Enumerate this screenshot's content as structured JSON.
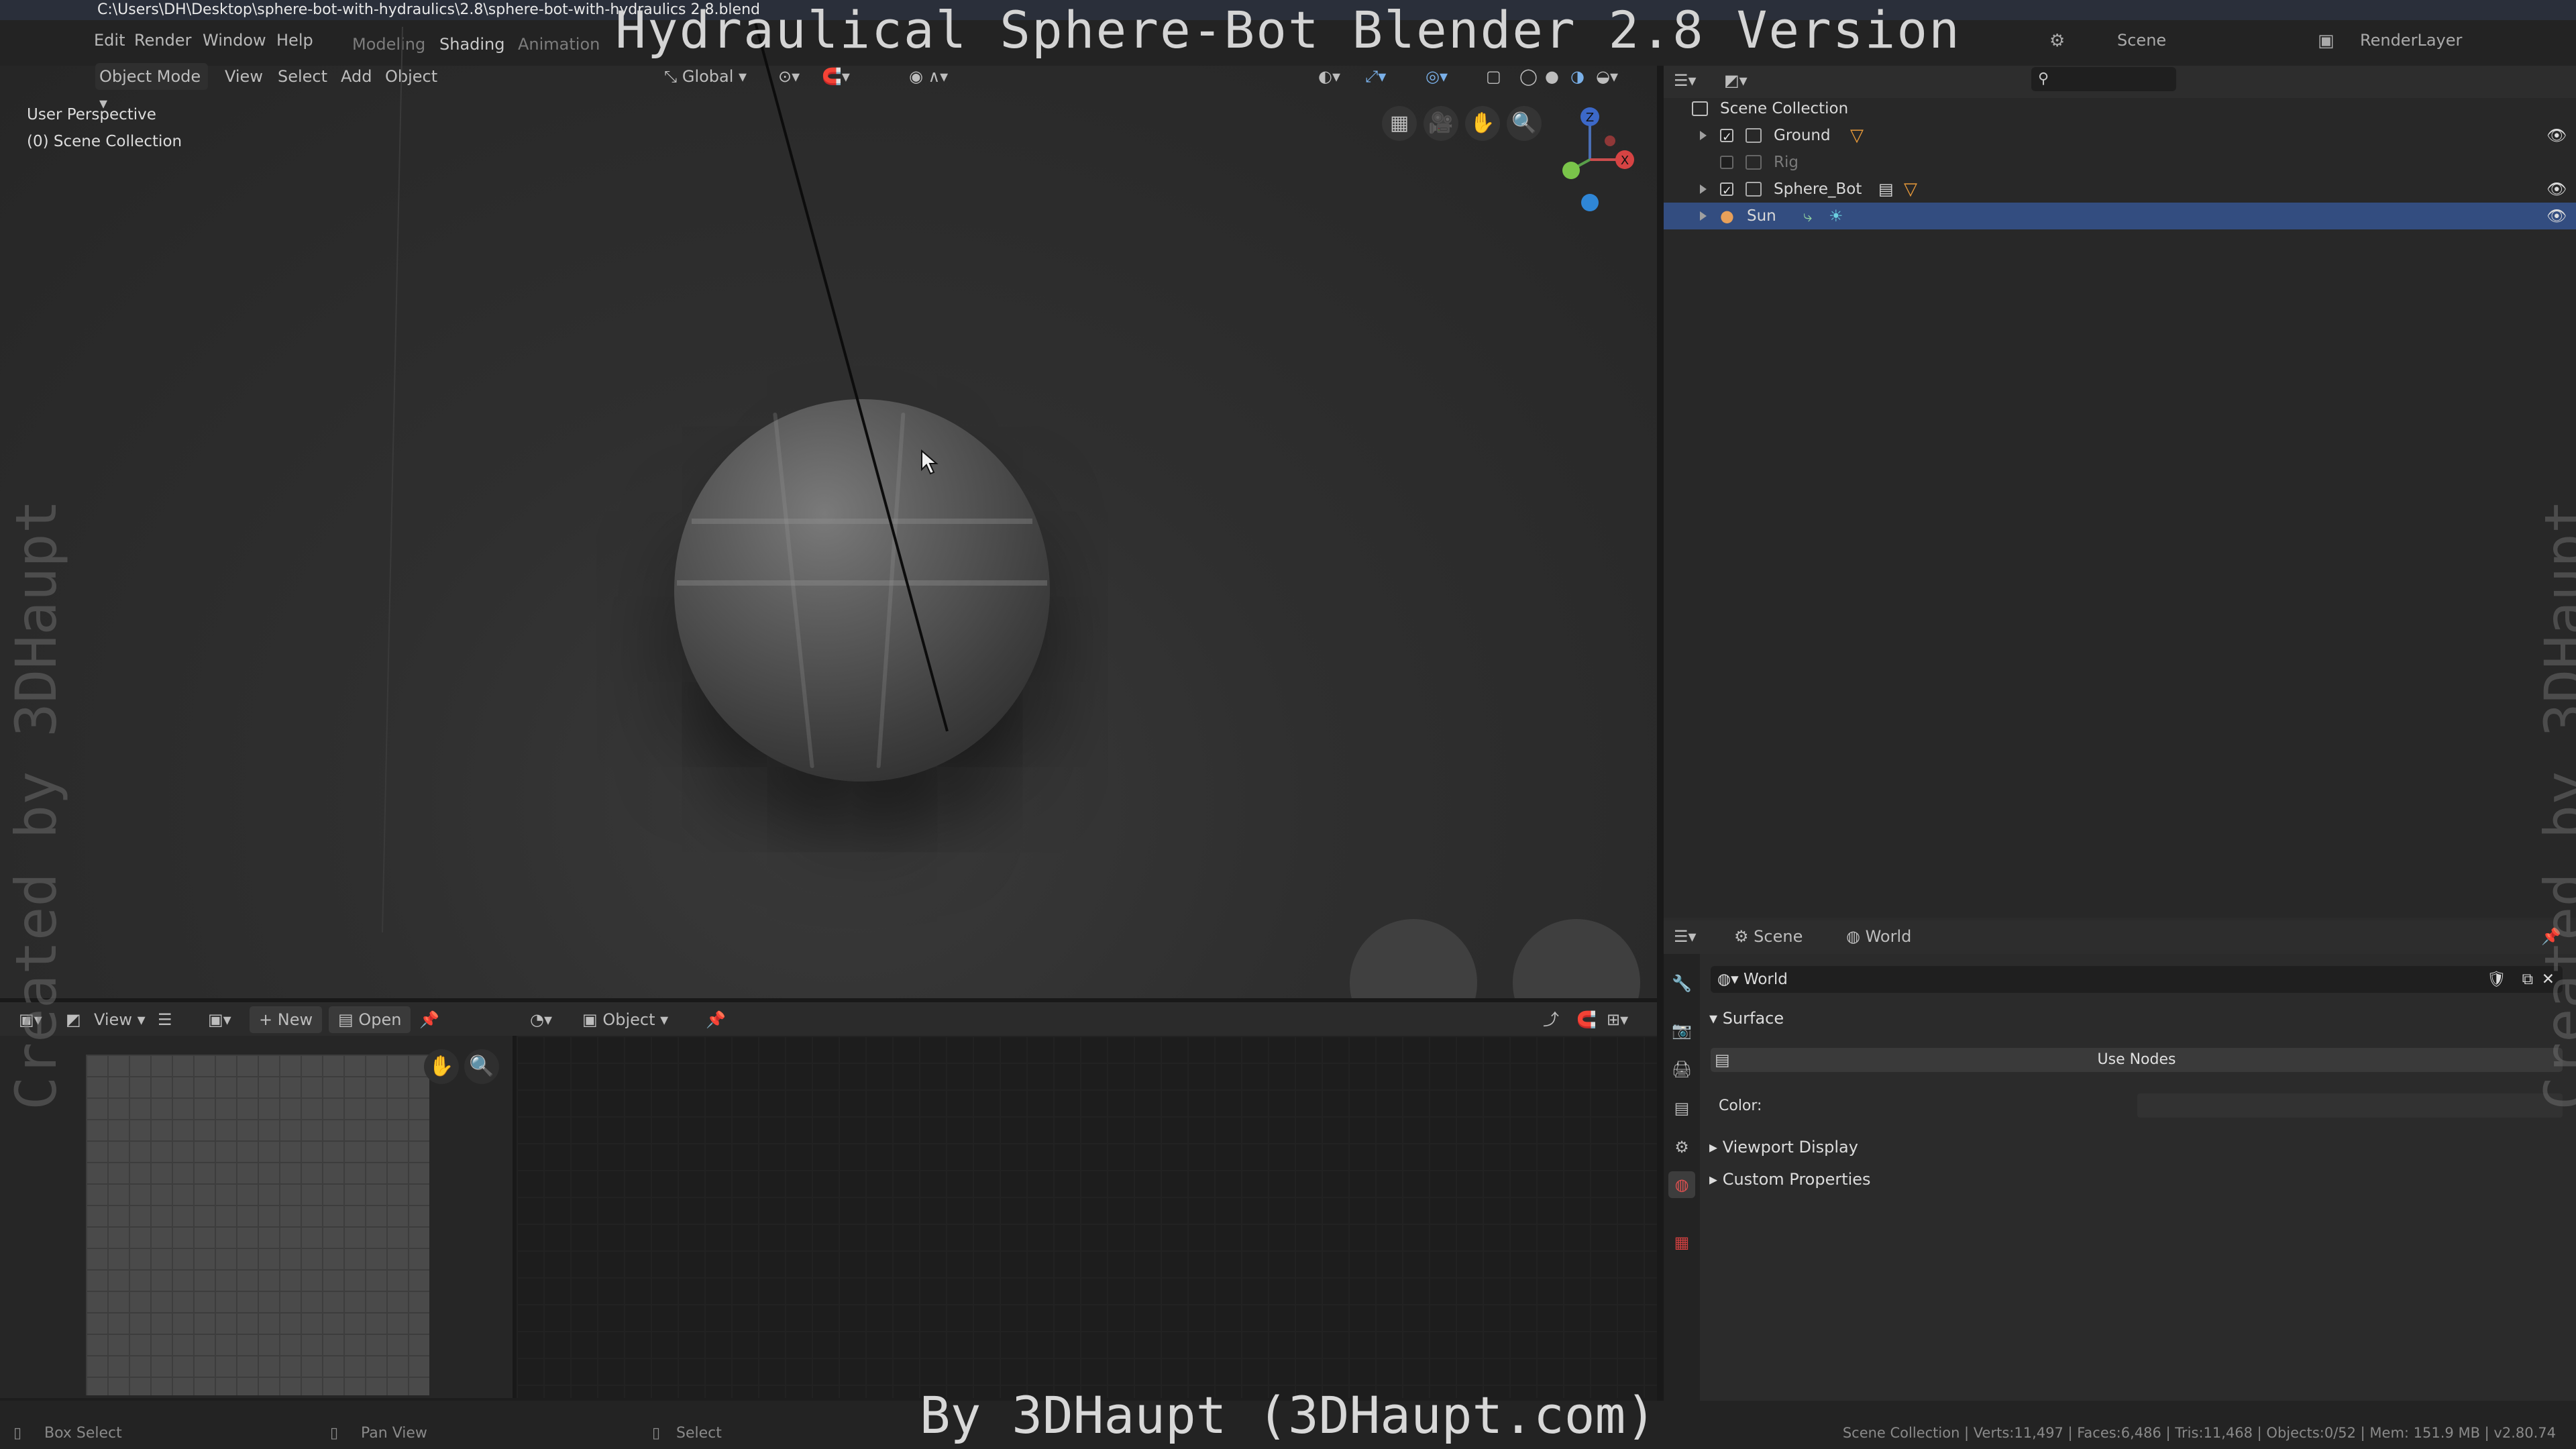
{
  "window": {
    "file_path": "C:\\Users\\DH\\Desktop\\sphere-bot-with-hydraulics\\2.8\\sphere-bot-with-hydraulics 2.8.blend"
  },
  "overlay": {
    "title": "Hydraulical Sphere-Bot Blender 2.8 Version",
    "byline": "By 3DHaupt (3DHaupt.com)",
    "watermark": "Created by 3DHaupt"
  },
  "topbar": {
    "menus": [
      "Edit",
      "Render",
      "Window",
      "Help"
    ],
    "workspaces": [
      "Modeling",
      "Shading",
      "Animation"
    ],
    "active_workspace": "Shading",
    "scene": "Scene",
    "render_layer": "RenderLayer"
  },
  "viewport": {
    "mode": "Object Mode",
    "menus": [
      "View",
      "Select",
      "Add",
      "Object"
    ],
    "orientation": "Global",
    "perspective_label": "User Perspective",
    "collection_label": "(0) Scene Collection",
    "gizmo": {
      "z": "Z",
      "x": "X"
    }
  },
  "image_editor": {
    "view": "View",
    "new": "New",
    "open": "Open"
  },
  "node_editor": {
    "object_dropdown": "Object"
  },
  "outliner": {
    "root": "Scene Collection",
    "items": [
      {
        "name": "Ground",
        "checked": true,
        "visible": true,
        "selected": false
      },
      {
        "name": "Rig",
        "checked": false,
        "visible": false,
        "selected": false
      },
      {
        "name": "Sphere_Bot",
        "checked": true,
        "visible": true,
        "selected": false
      },
      {
        "name": "Sun",
        "checked": false,
        "visible": true,
        "selected": true
      }
    ]
  },
  "properties": {
    "breadcrumb": [
      "Scene",
      "World"
    ],
    "world_name": "World",
    "surface_panel": "Surface",
    "use_nodes": "Use Nodes",
    "color_label": "Color:",
    "subpanels": [
      "Viewport Display",
      "Custom Properties"
    ]
  },
  "statusbar": {
    "left": "Box Select",
    "middle": "Pan View",
    "right": "Select",
    "stats": "Scene Collection | Verts:11,497 | Faces:6,486 | Tris:11,468 | Objects:0/52 | Mem: 151.9 MB | v2.80.74"
  }
}
